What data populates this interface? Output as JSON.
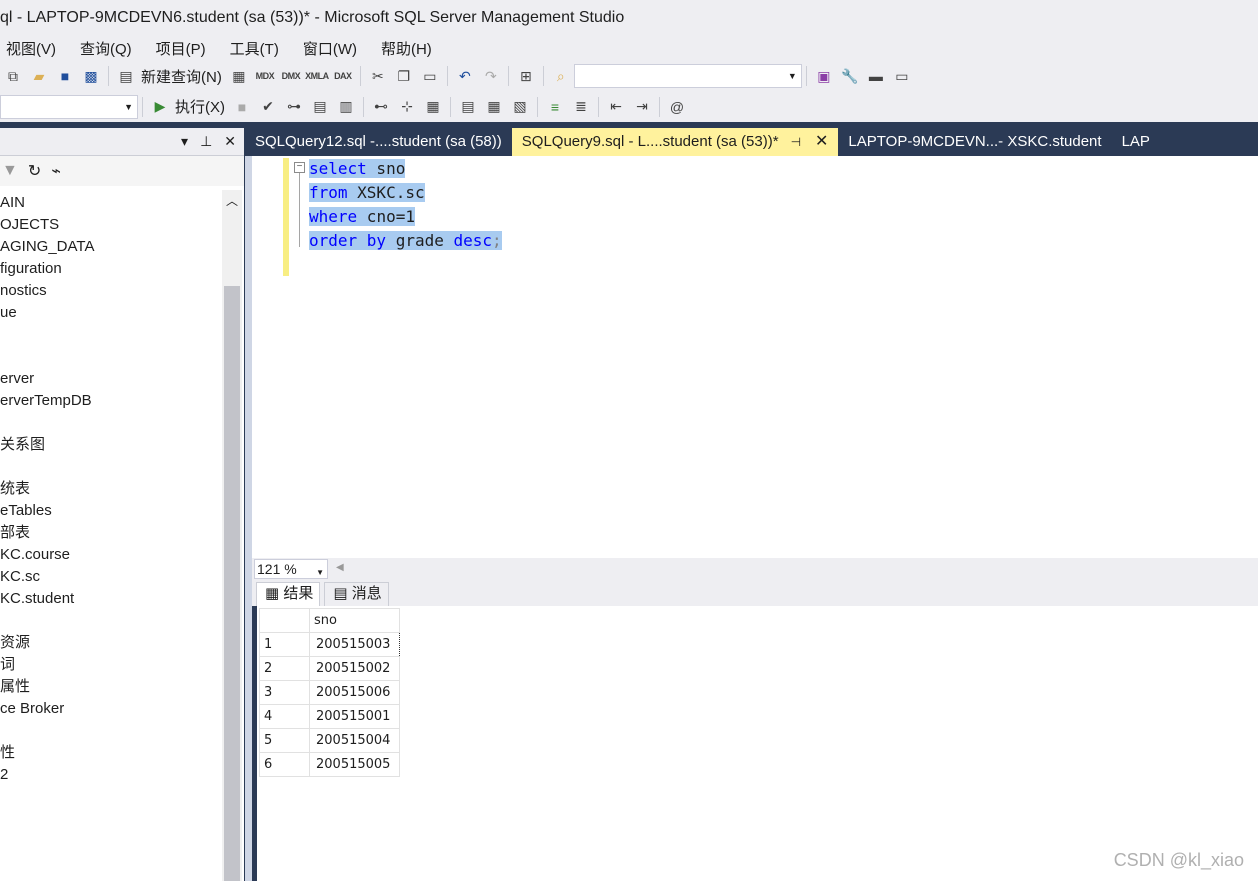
{
  "window": {
    "title": "ql - LAPTOP-9MCDEVN6.student (sa (53))* - Microsoft SQL Server Management Studio"
  },
  "menu": [
    "视图(V)",
    "查询(Q)",
    "项目(P)",
    "工具(T)",
    "窗口(W)",
    "帮助(H)"
  ],
  "toolbar1": {
    "new_query": "新建查询(N)",
    "mdx": "MDX",
    "dmx": "DMX",
    "xmla": "XMLA",
    "dax": "DAX",
    "search_value": ""
  },
  "toolbar2": {
    "execute": "执行(X)",
    "database_value": ""
  },
  "object_explorer": {
    "tree": [
      "AIN",
      "OJECTS",
      "AGING_DATA",
      "figuration",
      "nostics",
      "ue",
      "",
      "",
      "erver",
      "erverTempDB",
      "",
      "关系图",
      "",
      "统表",
      "eTables",
      "部表",
      "KC.course",
      "KC.sc",
      "KC.student",
      "",
      "资源",
      "词",
      "属性",
      "ce Broker",
      "",
      "性",
      "2",
      "",
      "",
      "",
      "",
      "",
      ""
    ]
  },
  "tabs": [
    {
      "label": "SQLQuery12.sql -....student (sa (58))",
      "active": false
    },
    {
      "label": "SQLQuery9.sql - L....student (sa (53))*",
      "active": true
    },
    {
      "label": "LAPTOP-9MCDEVN...- XSKC.student",
      "active": false
    },
    {
      "label": "LAP",
      "active": false
    }
  ],
  "editor": {
    "lines": [
      {
        "kw1": "select",
        "rest": " sno"
      },
      {
        "kw1": "from",
        "rest": " XSKC.sc"
      },
      {
        "kw1": "where",
        "rest": " cno=1"
      },
      {
        "kw1": "order by",
        "rest": " grade ",
        "kw2": "desc",
        "tail": ";"
      }
    ]
  },
  "zoom": "121 %",
  "result_tabs": {
    "results": "结果",
    "messages": "消息"
  },
  "results": {
    "columns": [
      "sno"
    ],
    "rows": [
      {
        "n": "1",
        "sno": "200515003"
      },
      {
        "n": "2",
        "sno": "200515002"
      },
      {
        "n": "3",
        "sno": "200515006"
      },
      {
        "n": "4",
        "sno": "200515001"
      },
      {
        "n": "5",
        "sno": "200515004"
      },
      {
        "n": "6",
        "sno": "200515005"
      }
    ]
  },
  "watermark": "CSDN @kl_xiao",
  "colors": {
    "chrome": "#eeeef2",
    "dark": "#2b3a55",
    "active_tab": "#fff29d",
    "selection": "#a8cbf0",
    "keyword": "#0000ff"
  }
}
